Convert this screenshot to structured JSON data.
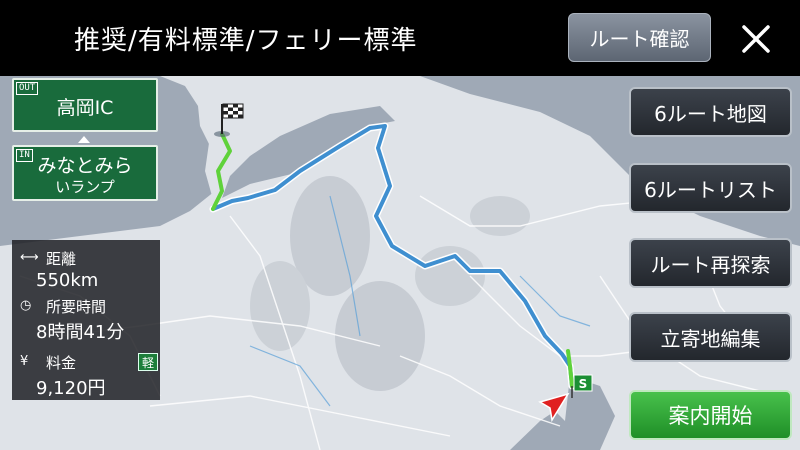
{
  "header": {
    "title": "推奨/有料標準/フェリー標準",
    "route_confirm_label": "ルート確認",
    "close_icon": "close-icon"
  },
  "highway": {
    "out_tag": "OUT",
    "out_name": "高岡IC",
    "in_tag": "IN",
    "in_name": "みなとみら",
    "in_sub": "いランプ",
    "color": "#196b3c"
  },
  "summary": {
    "distance_label": "距離",
    "distance_value": "550km",
    "time_label": "所要時間",
    "time_value": "8時間41分",
    "fee_label": "料金",
    "fee_value": "9,120円",
    "fee_badge": "軽"
  },
  "side_buttons": [
    {
      "label": "6ルート地図"
    },
    {
      "label": "6ルートリスト"
    },
    {
      "label": "ルート再探索"
    },
    {
      "label": "立寄地編集"
    }
  ],
  "start_button": {
    "label": "案内開始",
    "color": "#2fa834"
  },
  "map": {
    "start_marker_label": "S",
    "route_color": "#3f8fd0",
    "route_highlight_color": "#5fd23a",
    "vehicle_color": "#e02020"
  }
}
